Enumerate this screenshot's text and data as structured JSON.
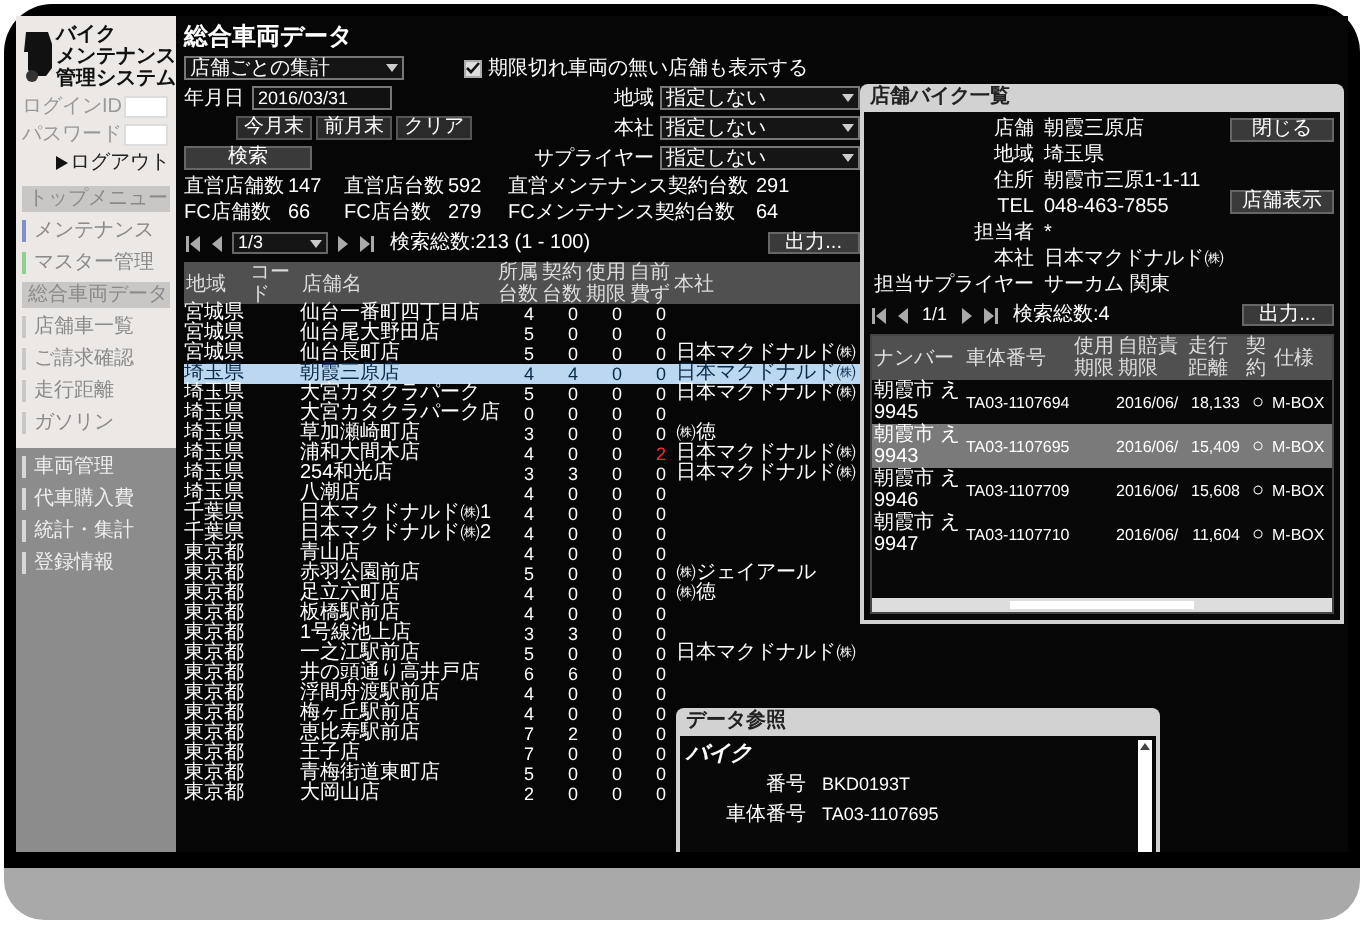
{
  "sidebar": {
    "logo_lines": [
      "バイク",
      "メンテナンス",
      "管理システム"
    ],
    "login_id_label": "ログインID",
    "password_label": "パスワード",
    "logout_button": "ログアウト",
    "items": [
      {
        "label": "トップメニュー",
        "kind": "header"
      },
      {
        "label": "メンテナンス",
        "kind": "item",
        "color": "#7f8fd0"
      },
      {
        "label": "マスター管理",
        "kind": "item",
        "color": "#8fd08f"
      },
      {
        "label": "総合車両データ",
        "kind": "header"
      },
      {
        "label": "店舗車一覧",
        "kind": "item",
        "color": "#c8c8c8"
      },
      {
        "label": "ご請求確認",
        "kind": "item",
        "color": "#c8c8c8"
      },
      {
        "label": "走行距離",
        "kind": "item",
        "color": "#c8c8c8"
      },
      {
        "label": "ガソリン",
        "kind": "item",
        "color": "#c8c8c8"
      }
    ],
    "lower_items": [
      {
        "label": "車両管理",
        "color": "#d8d8d8"
      },
      {
        "label": "代車購入費",
        "color": "#d8d8d8"
      },
      {
        "label": "統計・集計",
        "color": "#d8d8d8"
      },
      {
        "label": "登録情報",
        "color": "#d8d8d8"
      }
    ]
  },
  "main": {
    "title": "総合車両データ",
    "aggregate_select": "店舗ごとの集計",
    "show_expired": {
      "label": "期限切れ車両の無い店舗も表示する",
      "checked": true
    },
    "date": {
      "label": "年月日",
      "value": "2016/03/31"
    },
    "date_buttons": [
      "今月末",
      "前月末",
      "クリア"
    ],
    "search_button": "検索",
    "filters": [
      {
        "label": "地域",
        "value": "指定しない"
      },
      {
        "label": "本社",
        "value": "指定しない"
      },
      {
        "label": "サプライヤー",
        "value": "指定しない"
      }
    ],
    "stats": [
      [
        {
          "label": "直営店舗数",
          "value": "147"
        },
        {
          "label": "直営店台数",
          "value": "592"
        },
        {
          "label": "直営メンテナンス契約台数",
          "value": "291"
        }
      ],
      [
        {
          "label": "FC店舗数",
          "value": "66"
        },
        {
          "label": "FC店台数",
          "value": "279"
        },
        {
          "label": "FCメンテナンス契約台数",
          "value": "64"
        }
      ]
    ],
    "pager": {
      "page": "1/3",
      "total": "検索総数:213 (1 - 100)"
    },
    "export_button": "出力...",
    "table": {
      "columns": [
        "地域",
        "コード",
        "店舗名",
        "所属台数",
        "契約台数",
        "使用期限",
        "自前費ず",
        "本社"
      ],
      "rows": [
        {
          "region": "宮城県",
          "name": "仙台一番町四丁目店",
          "counts": [
            "4",
            "0",
            "0",
            "0"
          ],
          "selected": false,
          "alert": false
        },
        {
          "region": "宮城県",
          "name": "仙台尾大野田店",
          "counts": [
            "5",
            "0",
            "0",
            "0"
          ],
          "selected": false,
          "alert": false
        },
        {
          "region": "宮城県",
          "name": "仙台長町店",
          "counts": [
            "5",
            "0",
            "0",
            "0"
          ],
          "head_office": "日本マクドナルド㈱",
          "selected": false,
          "alert": false
        },
        {
          "region": "埼玉県",
          "name": "朝霞三原店",
          "counts": [
            "4",
            "4",
            "0",
            "0"
          ],
          "head_office": "日本マクドナルド㈱",
          "selected": true,
          "alert": false
        },
        {
          "region": "埼玉県",
          "name": "大宮カタクラパーク",
          "counts": [
            "5",
            "0",
            "0",
            "0"
          ],
          "head_office": "日本マクドナルド㈱",
          "selected": false,
          "alert": false
        },
        {
          "region": "埼玉県",
          "name": "大宮カタクラパーク店",
          "counts": [
            "0",
            "0",
            "0",
            "0"
          ],
          "selected": false,
          "alert": false
        },
        {
          "region": "埼玉県",
          "name": "草加瀬崎町店",
          "counts": [
            "3",
            "0",
            "0",
            "0"
          ],
          "head_office": "㈱徳",
          "selected": false,
          "alert": false
        },
        {
          "region": "埼玉県",
          "name": "浦和大間木店",
          "counts": [
            "4",
            "0",
            "0",
            "2"
          ],
          "head_office": "日本マクドナルド㈱",
          "selected": false,
          "alert": true
        },
        {
          "region": "埼玉県",
          "name": "254和光店",
          "counts": [
            "3",
            "3",
            "0",
            "0"
          ],
          "head_office": "日本マクドナルド㈱",
          "selected": false,
          "alert": false
        },
        {
          "region": "埼玉県",
          "name": "八潮店",
          "counts": [
            "4",
            "0",
            "0",
            "0"
          ],
          "selected": false,
          "alert": false
        },
        {
          "region": "千葉県",
          "name": "日本マクドナルド㈱1",
          "counts": [
            "4",
            "0",
            "0",
            "0"
          ],
          "selected": false,
          "alert": false
        },
        {
          "region": "千葉県",
          "name": "日本マクドナルド㈱2",
          "counts": [
            "4",
            "0",
            "0",
            "0"
          ],
          "selected": false,
          "alert": false
        },
        {
          "region": "東京都",
          "name": "青山店",
          "counts": [
            "4",
            "0",
            "0",
            "0"
          ],
          "selected": false,
          "alert": false
        },
        {
          "region": "東京都",
          "name": "赤羽公園前店",
          "counts": [
            "5",
            "0",
            "0",
            "0"
          ],
          "head_office": "㈱ジェイアール",
          "selected": false,
          "alert": false
        },
        {
          "region": "東京都",
          "name": "足立六町店",
          "counts": [
            "4",
            "0",
            "0",
            "0"
          ],
          "head_office": "㈱徳",
          "selected": false,
          "alert": false
        },
        {
          "region": "東京都",
          "name": "板橋駅前店",
          "counts": [
            "4",
            "0",
            "0",
            "0"
          ],
          "selected": false,
          "alert": false
        },
        {
          "region": "東京都",
          "name": "1号線池上店",
          "counts": [
            "3",
            "3",
            "0",
            "0"
          ],
          "selected": false,
          "alert": false
        },
        {
          "region": "東京都",
          "name": "一之江駅前店",
          "counts": [
            "5",
            "0",
            "0",
            "0"
          ],
          "head_office": "日本マクドナルド㈱",
          "selected": false,
          "alert": false
        },
        {
          "region": "東京都",
          "name": "井の頭通り高井戸店",
          "counts": [
            "6",
            "6",
            "0",
            "0"
          ],
          "selected": false,
          "alert": false
        },
        {
          "region": "東京都",
          "name": "浮間舟渡駅前店",
          "counts": [
            "4",
            "0",
            "0",
            "0"
          ],
          "selected": false,
          "alert": false
        },
        {
          "region": "東京都",
          "name": "梅ヶ丘駅前店",
          "counts": [
            "4",
            "0",
            "0",
            "0"
          ],
          "selected": false,
          "alert": false
        },
        {
          "region": "東京都",
          "name": "恵比寿駅前店",
          "counts": [
            "7",
            "2",
            "0",
            "0"
          ],
          "selected": false,
          "alert": false
        },
        {
          "region": "東京都",
          "name": "王子店",
          "counts": [
            "7",
            "0",
            "0",
            "0"
          ],
          "selected": false,
          "alert": false
        },
        {
          "region": "東京都",
          "name": "青梅街道東町店",
          "counts": [
            "5",
            "0",
            "0",
            "0"
          ],
          "selected": false,
          "alert": false
        },
        {
          "region": "東京都",
          "name": "大岡山店",
          "counts": [
            "2",
            "0",
            "0",
            "0"
          ],
          "selected": false,
          "alert": false
        }
      ]
    }
  },
  "shop_popup": {
    "title": "店舗バイク一覧",
    "fields": [
      {
        "label": "店舗",
        "value": "朝霞三原店"
      },
      {
        "label": "地域",
        "value": "埼玉県"
      },
      {
        "label": "住所",
        "value": "朝霞市三原1-1-11"
      },
      {
        "label": "TEL",
        "value": "048-463-7855"
      },
      {
        "label": "担当者",
        "value": "*"
      },
      {
        "label": "本社",
        "value": "日本マクドナルド㈱"
      },
      {
        "label": "担当サプライヤー",
        "value": "サーカム 関東"
      }
    ],
    "buttons": [
      "閉じる",
      "店舗表示"
    ],
    "pager": {
      "page": "1/1",
      "total": "検索総数:4"
    },
    "export_button": "出力...",
    "table": {
      "columns": [
        "ナンバー",
        "車体番号",
        "使用期限",
        "自賠責期限",
        "走行距離",
        "契約",
        "仕様"
      ],
      "rows": [
        {
          "number": "朝霞市 え 9945",
          "body": "TA03-1107694",
          "insurance": "2016/06/",
          "distance": "18,133",
          "contract": "○",
          "spec": "M-BOX",
          "selected": false
        },
        {
          "number": "朝霞市 え 9943",
          "body": "TA03-1107695",
          "insurance": "2016/06/",
          "distance": "15,409",
          "contract": "○",
          "spec": "M-BOX",
          "selected": true
        },
        {
          "number": "朝霞市 え 9946",
          "body": "TA03-1107709",
          "insurance": "2016/06/",
          "distance": "15,608",
          "contract": "○",
          "spec": "M-BOX",
          "selected": false
        },
        {
          "number": "朝霞市 え 9947",
          "body": "TA03-1107710",
          "insurance": "2016/06/",
          "distance": "11,604",
          "contract": "○",
          "spec": "M-BOX",
          "selected": false
        }
      ]
    }
  },
  "data_popup": {
    "title": "データ参照",
    "section": "バイク",
    "fields": [
      {
        "label": "番号",
        "value": "BKD0193T"
      },
      {
        "label": "車体番号",
        "value": "TA03-1107695"
      }
    ]
  }
}
